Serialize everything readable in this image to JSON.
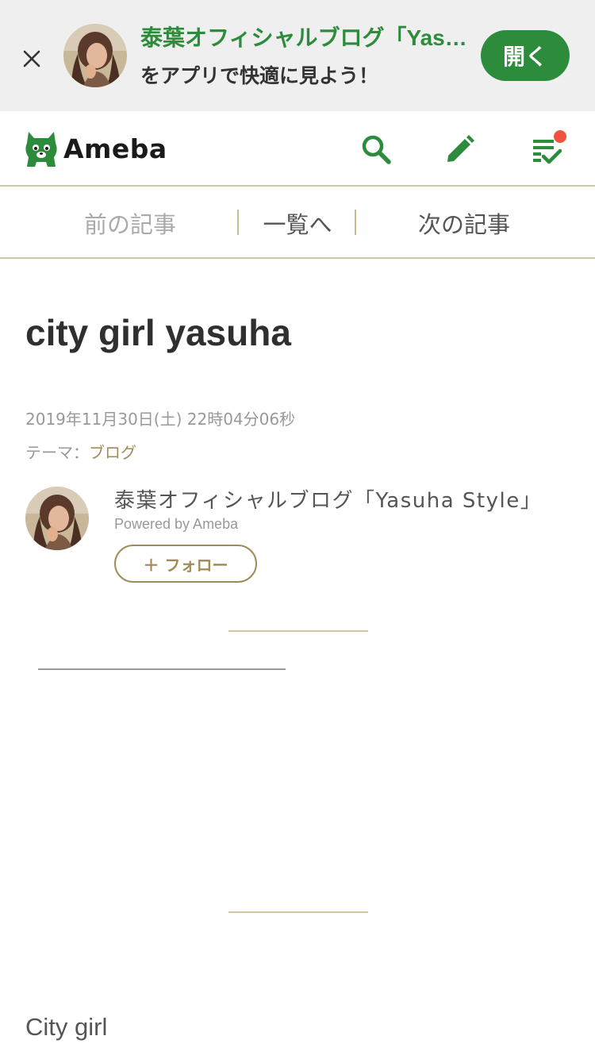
{
  "banner": {
    "title": "泰葉オフィシャルブログ「Yasuha Style」",
    "subtitle": "をアプリで快適に見よう！",
    "open_label": "開く"
  },
  "header": {
    "logo_text": "Ameba",
    "icons": [
      "search-icon",
      "pencil-icon",
      "checklist-icon"
    ]
  },
  "pager": {
    "prev_label": "前の記事",
    "list_label": "一覧へ",
    "next_label": "次の記事"
  },
  "article": {
    "title": "city girl yasuha",
    "date": "2019年11月30日(土) 22時04分06秒",
    "theme_prefix": "テーマ：",
    "theme": "ブログ",
    "body_text": "City girl"
  },
  "author": {
    "blog_name": "泰葉オフィシャルブログ「Yasuha Style」",
    "powered_by": "Powered by Ameba",
    "follow_label": "＋ フォロー"
  },
  "colors": {
    "brand_green": "#2d8c3c",
    "accent_gold": "#a08c5a",
    "notification_red": "#f0533f"
  }
}
